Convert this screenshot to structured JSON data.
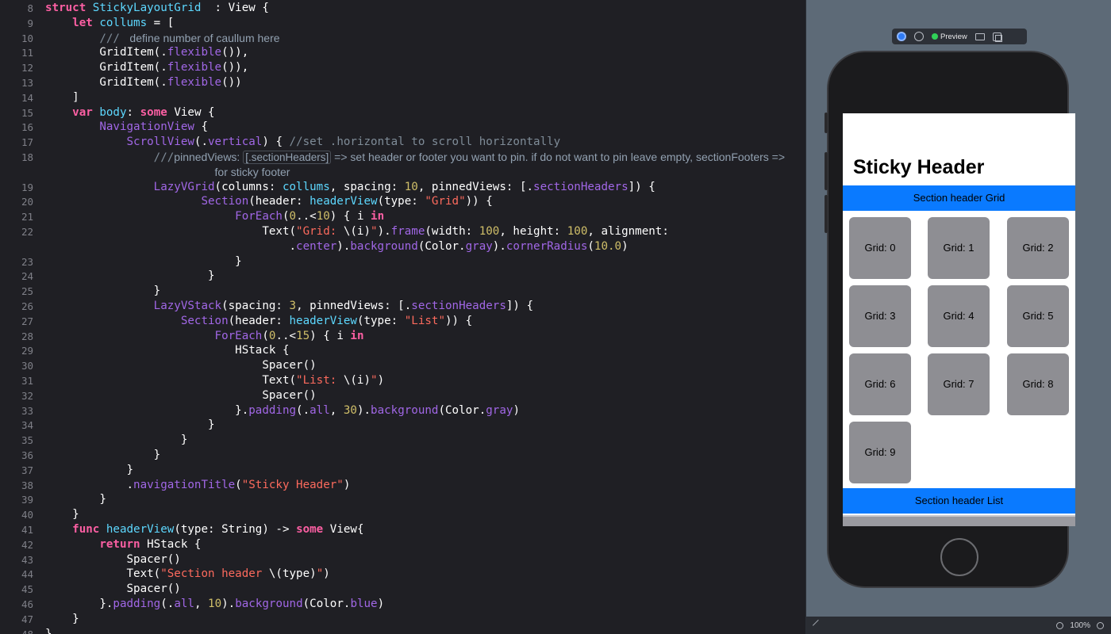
{
  "editor": {
    "lines": [
      {
        "n": "8",
        "s": [
          [
            "kw",
            "struct "
          ],
          [
            "type",
            "StickyLayoutGrid"
          ],
          [
            "",
            "  : View {"
          ]
        ]
      },
      {
        "n": "9",
        "s": [
          [
            "",
            "    "
          ],
          [
            "kw",
            "let "
          ],
          [
            "type",
            "collums"
          ],
          [
            "",
            " = ["
          ]
        ]
      },
      {
        "n": "10",
        "s": [
          [
            "",
            "        "
          ],
          [
            "cmt",
            "/// "
          ],
          [
            "doc",
            " define number of caullum here"
          ]
        ]
      },
      {
        "n": "11",
        "s": [
          [
            "",
            "        GridItem(."
          ],
          [
            "fn",
            "flexible"
          ],
          [
            "",
            "()),"
          ]
        ]
      },
      {
        "n": "12",
        "s": [
          [
            "",
            "        GridItem(."
          ],
          [
            "fn",
            "flexible"
          ],
          [
            "",
            "()),"
          ]
        ]
      },
      {
        "n": "13",
        "s": [
          [
            "",
            "        GridItem(."
          ],
          [
            "fn",
            "flexible"
          ],
          [
            "",
            "())"
          ]
        ]
      },
      {
        "n": "14",
        "s": [
          [
            "",
            "    ]"
          ]
        ]
      },
      {
        "n": "15",
        "s": [
          [
            "",
            "    "
          ],
          [
            "kw",
            "var "
          ],
          [
            "type",
            "body"
          ],
          [
            "",
            ": "
          ],
          [
            "kw",
            "some "
          ],
          [
            "",
            "View {"
          ]
        ]
      },
      {
        "n": "16",
        "s": [
          [
            "",
            "        "
          ],
          [
            "fn",
            "NavigationView"
          ],
          [
            "",
            " {"
          ]
        ]
      },
      {
        "n": "17",
        "s": [
          [
            "",
            "            "
          ],
          [
            "fn",
            "ScrollView"
          ],
          [
            "",
            "(."
          ],
          [
            "fn",
            "vertical"
          ],
          [
            "",
            ") { "
          ],
          [
            "cmt",
            "//set .horizontal to scroll horizontally"
          ]
        ]
      },
      {
        "n": "18",
        "s": [
          [
            "",
            "                "
          ],
          [
            "cmt",
            "///"
          ],
          [
            "doc",
            "pinnedViews: "
          ],
          [
            "dockw",
            "[.sectionHeaders]"
          ],
          [
            "doc",
            " => set header or footer you want to pin. if do not want to pin leave empty, sectionFooters =>"
          ]
        ]
      },
      {
        "n": "",
        "s": [
          [
            "",
            "                         "
          ],
          [
            "doc",
            "for sticky footer"
          ]
        ]
      },
      {
        "n": "19",
        "s": [
          [
            "",
            "                "
          ],
          [
            "fn",
            "LazyVGrid"
          ],
          [
            "",
            "(columns: "
          ],
          [
            "type",
            "collums"
          ],
          [
            "",
            ", spacing: "
          ],
          [
            "num",
            "10"
          ],
          [
            "",
            ", pinnedViews: [."
          ],
          [
            "fn",
            "sectionHeaders"
          ],
          [
            "",
            "]) {"
          ]
        ]
      },
      {
        "n": "20",
        "s": [
          [
            "",
            "                       "
          ],
          [
            "fn",
            "Section"
          ],
          [
            "",
            "(header: "
          ],
          [
            "type",
            "headerView"
          ],
          [
            "",
            "(type: "
          ],
          [
            "str",
            "\"Grid\""
          ],
          [
            "",
            ")) {"
          ]
        ]
      },
      {
        "n": "21",
        "s": [
          [
            "",
            "                            "
          ],
          [
            "fn",
            "ForEach"
          ],
          [
            "",
            "("
          ],
          [
            "num",
            "0"
          ],
          [
            "",
            "..<"
          ],
          [
            "num",
            "10"
          ],
          [
            "",
            ") { i "
          ],
          [
            "kw",
            "in"
          ]
        ]
      },
      {
        "n": "22",
        "s": [
          [
            "",
            "                                Text("
          ],
          [
            "str",
            "\"Grid: "
          ],
          [
            "",
            "\\(i)"
          ],
          [
            "str",
            "\""
          ],
          [
            "",
            ")."
          ],
          [
            "fn",
            "frame"
          ],
          [
            "",
            "(width: "
          ],
          [
            "num",
            "100"
          ],
          [
            "",
            ", height: "
          ],
          [
            "num",
            "100"
          ],
          [
            "",
            ", alignment:"
          ]
        ]
      },
      {
        "n": "",
        "s": [
          [
            "",
            "                                    ."
          ],
          [
            "fn",
            "center"
          ],
          [
            "",
            ")."
          ],
          [
            "fn",
            "background"
          ],
          [
            "",
            "(Color."
          ],
          [
            "fn",
            "gray"
          ],
          [
            "",
            ")."
          ],
          [
            "fn",
            "cornerRadius"
          ],
          [
            "",
            "("
          ],
          [
            "num",
            "10.0"
          ],
          [
            "",
            ")"
          ]
        ]
      },
      {
        "n": "23",
        "s": [
          [
            "",
            "                            }"
          ]
        ]
      },
      {
        "n": "24",
        "s": [
          [
            "",
            "                        }"
          ]
        ]
      },
      {
        "n": "25",
        "s": [
          [
            "",
            "                }"
          ]
        ]
      },
      {
        "n": "26",
        "s": [
          [
            "",
            "                "
          ],
          [
            "fn",
            "LazyVStack"
          ],
          [
            "",
            "(spacing: "
          ],
          [
            "num",
            "3"
          ],
          [
            "",
            ", pinnedViews: [."
          ],
          [
            "fn",
            "sectionHeaders"
          ],
          [
            "",
            "]) {"
          ]
        ]
      },
      {
        "n": "27",
        "s": [
          [
            "",
            "                    "
          ],
          [
            "fn",
            "Section"
          ],
          [
            "",
            "(header: "
          ],
          [
            "type",
            "headerView"
          ],
          [
            "",
            "(type: "
          ],
          [
            "str",
            "\"List\""
          ],
          [
            "",
            ")) {"
          ]
        ]
      },
      {
        "n": "28",
        "s": [
          [
            "",
            "                         "
          ],
          [
            "fn",
            "ForEach"
          ],
          [
            "",
            "("
          ],
          [
            "num",
            "0"
          ],
          [
            "",
            "..<"
          ],
          [
            "num",
            "15"
          ],
          [
            "",
            ") { i "
          ],
          [
            "kw",
            "in"
          ]
        ]
      },
      {
        "n": "29",
        "s": [
          [
            "",
            "                            HStack {"
          ]
        ]
      },
      {
        "n": "30",
        "s": [
          [
            "",
            "                                Spacer()"
          ]
        ]
      },
      {
        "n": "31",
        "s": [
          [
            "",
            "                                Text("
          ],
          [
            "str",
            "\"List: "
          ],
          [
            "",
            "\\(i)"
          ],
          [
            "str",
            "\""
          ],
          [
            "",
            ")"
          ]
        ]
      },
      {
        "n": "32",
        "s": [
          [
            "",
            "                                Spacer()"
          ]
        ]
      },
      {
        "n": "33",
        "s": [
          [
            "",
            "                            }."
          ],
          [
            "fn",
            "padding"
          ],
          [
            "",
            "(."
          ],
          [
            "fn",
            "all"
          ],
          [
            "",
            ", "
          ],
          [
            "num",
            "30"
          ],
          [
            "",
            ")."
          ],
          [
            "fn",
            "background"
          ],
          [
            "",
            "(Color."
          ],
          [
            "fn",
            "gray"
          ],
          [
            "",
            ")"
          ]
        ]
      },
      {
        "n": "34",
        "s": [
          [
            "",
            "                        }"
          ]
        ]
      },
      {
        "n": "35",
        "s": [
          [
            "",
            "                    }"
          ]
        ]
      },
      {
        "n": "36",
        "s": [
          [
            "",
            "                }"
          ]
        ]
      },
      {
        "n": "37",
        "s": [
          [
            "",
            "            }"
          ]
        ]
      },
      {
        "n": "38",
        "s": [
          [
            "",
            "            ."
          ],
          [
            "fn",
            "navigationTitle"
          ],
          [
            "",
            "("
          ],
          [
            "str",
            "\"Sticky Header\""
          ],
          [
            "",
            ")"
          ]
        ]
      },
      {
        "n": "39",
        "s": [
          [
            "",
            "        }"
          ]
        ]
      },
      {
        "n": "40",
        "s": [
          [
            "",
            "    }"
          ]
        ]
      },
      {
        "n": "41",
        "s": [
          [
            "",
            "    "
          ],
          [
            "kw",
            "func "
          ],
          [
            "type",
            "headerView"
          ],
          [
            "",
            "(type: String) -> "
          ],
          [
            "kw",
            "some "
          ],
          [
            "",
            "View{"
          ]
        ]
      },
      {
        "n": "42",
        "s": [
          [
            "",
            "        "
          ],
          [
            "kw",
            "return "
          ],
          [
            "",
            "HStack {"
          ]
        ]
      },
      {
        "n": "43",
        "s": [
          [
            "",
            "            Spacer()"
          ]
        ]
      },
      {
        "n": "44",
        "s": [
          [
            "",
            "            Text("
          ],
          [
            "str",
            "\"Section header "
          ],
          [
            "",
            "\\(type)"
          ],
          [
            "str",
            "\""
          ],
          [
            "",
            ")"
          ]
        ]
      },
      {
        "n": "45",
        "s": [
          [
            "",
            "            Spacer()"
          ]
        ]
      },
      {
        "n": "46",
        "s": [
          [
            "",
            "        }."
          ],
          [
            "fn",
            "padding"
          ],
          [
            "",
            "(."
          ],
          [
            "fn",
            "all"
          ],
          [
            "",
            ", "
          ],
          [
            "num",
            "10"
          ],
          [
            "",
            ")."
          ],
          [
            "fn",
            "background"
          ],
          [
            "",
            "(Color."
          ],
          [
            "fn",
            "blue"
          ],
          [
            "",
            ")"
          ]
        ]
      },
      {
        "n": "47",
        "s": [
          [
            "",
            "    }"
          ]
        ]
      },
      {
        "n": "48",
        "s": [
          [
            "",
            "}"
          ]
        ]
      }
    ]
  },
  "preview": {
    "toolbar": {
      "live_icon": "live-preview-icon",
      "inspect_icon": "inspect-icon",
      "preview_label": "Preview",
      "preview_dot_color": "#30d158",
      "device_icon": "device-settings-icon",
      "duplicate_icon": "duplicate-preview-icon"
    },
    "screen": {
      "nav_title": "Sticky Header",
      "grid_header": "Section header Grid",
      "list_header": "Section header List",
      "header_color": "#0a7aff",
      "cell_color": "#8e8e93",
      "grid_cells": [
        "Grid: 0",
        "Grid: 1",
        "Grid: 2",
        "Grid: 3",
        "Grid: 4",
        "Grid: 5",
        "Grid: 6",
        "Grid: 7",
        "Grid: 8",
        "Grid: 9"
      ]
    },
    "status_bar": {
      "pin_icon": "pin-icon",
      "zoom_out_icon": "zoom-out-icon",
      "zoom_level": "100%",
      "zoom_in_icon": "zoom-in-icon"
    }
  }
}
